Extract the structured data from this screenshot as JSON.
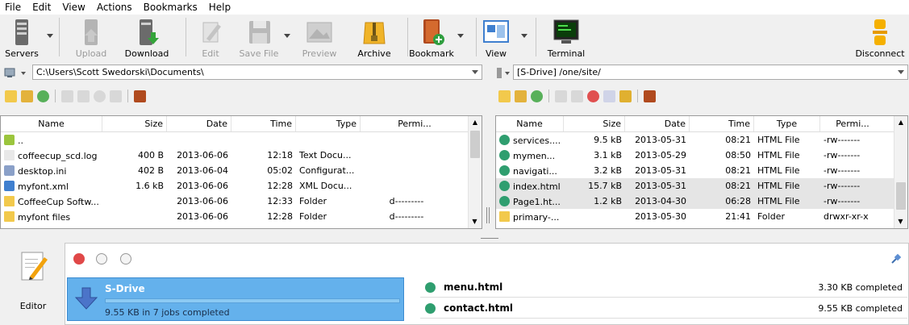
{
  "menu": [
    "File",
    "Edit",
    "View",
    "Actions",
    "Bookmarks",
    "Help"
  ],
  "toolbar": {
    "servers": "Servers",
    "upload": "Upload",
    "download": "Download",
    "edit": "Edit",
    "save_file": "Save File",
    "preview": "Preview",
    "archive": "Archive",
    "bookmark": "Bookmark",
    "view": "View",
    "terminal": "Terminal",
    "disconnect": "Disconnect"
  },
  "local": {
    "path": "C:\\Users\\Scott Swedorski\\Documents\\",
    "columns": [
      "Name",
      "Size",
      "Date",
      "Time",
      "Type",
      "Permi..."
    ],
    "rows": [
      {
        "name": "..",
        "size": "",
        "date": "",
        "time": "",
        "type": "",
        "perm": ""
      },
      {
        "name": "coffeecup_scd.log",
        "size": "400 B",
        "date": "2013-06-06",
        "time": "12:18",
        "type": "Text Docu...",
        "perm": ""
      },
      {
        "name": "desktop.ini",
        "size": "402 B",
        "date": "2013-06-04",
        "time": "05:02",
        "type": "Configurat...",
        "perm": ""
      },
      {
        "name": "myfont.xml",
        "size": "1.6 kB",
        "date": "2013-06-06",
        "time": "12:28",
        "type": "XML Docu...",
        "perm": ""
      },
      {
        "name": "CoffeeCup Softw...",
        "size": "",
        "date": "2013-06-06",
        "time": "12:33",
        "type": "Folder",
        "perm": "d---------"
      },
      {
        "name": "myfont files",
        "size": "",
        "date": "2013-06-06",
        "time": "12:28",
        "type": "Folder",
        "perm": "d---------"
      }
    ]
  },
  "remote": {
    "path": "[S-Drive] /one/site/",
    "columns": [
      "Name",
      "Size",
      "Date",
      "Time",
      "Type",
      "Permi..."
    ],
    "rows": [
      {
        "name": "services....",
        "size": "9.5 kB",
        "date": "2013-05-31",
        "time": "08:21",
        "type": "HTML File",
        "perm": "-rw-------"
      },
      {
        "name": "mymen...",
        "size": "3.1 kB",
        "date": "2013-05-29",
        "time": "08:50",
        "type": "HTML File",
        "perm": "-rw-------"
      },
      {
        "name": "navigati...",
        "size": "3.2 kB",
        "date": "2013-05-31",
        "time": "08:21",
        "type": "HTML File",
        "perm": "-rw-------"
      },
      {
        "name": "index.html",
        "size": "15.7 kB",
        "date": "2013-05-31",
        "time": "08:21",
        "type": "HTML File",
        "perm": "-rw-------"
      },
      {
        "name": "Page1.ht...",
        "size": "1.2 kB",
        "date": "2013-04-30",
        "time": "06:28",
        "type": "HTML File",
        "perm": "-rw-------"
      },
      {
        "name": "primary-...",
        "size": "",
        "date": "2013-05-30",
        "time": "21:41",
        "type": "Folder",
        "perm": "drwxr-xr-x"
      }
    ]
  },
  "editor": {
    "label": "Editor"
  },
  "transfer": {
    "server": "S-Drive",
    "summary": "9.55 KB in 7 jobs completed",
    "files": [
      {
        "name": "menu.html",
        "status": "3.30 KB completed"
      },
      {
        "name": "contact.html",
        "status": "9.55 KB completed"
      }
    ]
  },
  "colors": {
    "selected_transfer": "#64b1ec",
    "folder": "#f2c94c",
    "accent": "#3f7fcf"
  }
}
